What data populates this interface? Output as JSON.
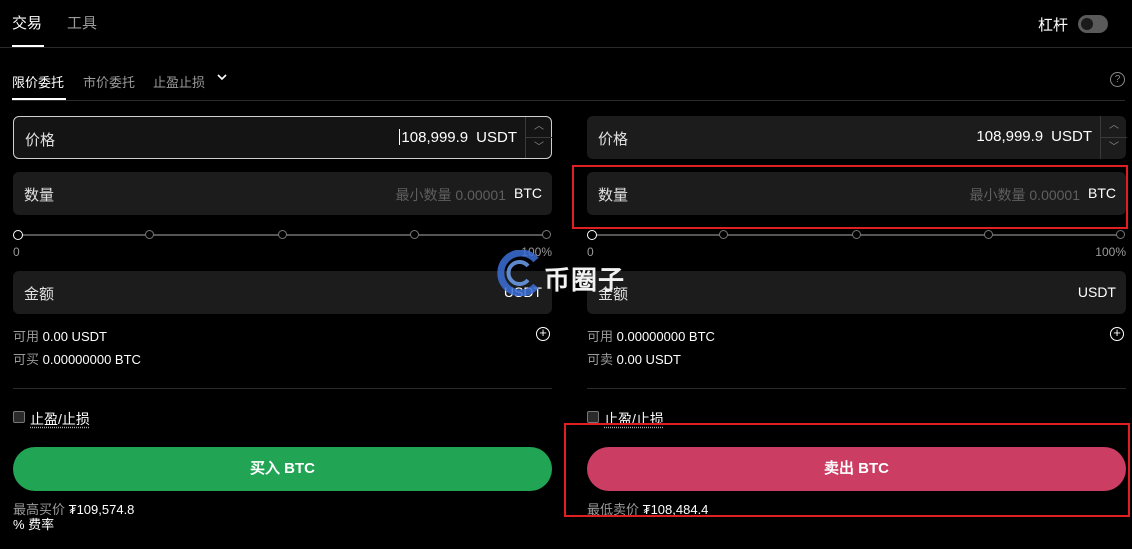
{
  "top_tabs": [
    "交易",
    "工具"
  ],
  "leverage": {
    "label": "杠杆"
  },
  "order_tabs": [
    "限价委托",
    "市价委托",
    "止盈止损"
  ],
  "help_glyph": "?",
  "buy_panel": {
    "price": {
      "label": "价格",
      "value": "108,999.9",
      "unit": "USDT"
    },
    "quantity": {
      "label": "数量",
      "placeholder": "最小数量 0.00001",
      "unit": "BTC"
    },
    "slider": {
      "min": "0",
      "max": "100%",
      "value_percent": 0
    },
    "amount": {
      "label": "金额",
      "unit": "USDT"
    },
    "available": {
      "label": "可用",
      "value": "0.00 USDT"
    },
    "can_trade": {
      "label": "可买",
      "value": "0.00000000 BTC"
    },
    "tpsl_label": "止盈/止损",
    "action_label": "买入 BTC",
    "best_price": {
      "label": "最高买价",
      "value": "₮109,574.8"
    }
  },
  "sell_panel": {
    "price": {
      "label": "价格",
      "value": "108,999.9",
      "unit": "USDT"
    },
    "quantity": {
      "label": "数量",
      "placeholder": "最小数量 0.00001",
      "unit": "BTC"
    },
    "slider": {
      "min": "0",
      "max": "100%",
      "value_percent": 0
    },
    "amount": {
      "label": "金额",
      "unit": "USDT"
    },
    "available": {
      "label": "可用",
      "value": "0.00000000 BTC"
    },
    "can_trade": {
      "label": "可卖",
      "value": "0.00 USDT"
    },
    "tpsl_label": "止盈/止损",
    "action_label": "卖出 BTC",
    "best_price": {
      "label": "最低卖价",
      "value": "₮108,484.4"
    }
  },
  "fees_label": "% 费率",
  "watermark_text": "币圈子",
  "colors": {
    "buy": "#22a455",
    "sell": "#cc3d63",
    "highlight": "#e02020"
  }
}
